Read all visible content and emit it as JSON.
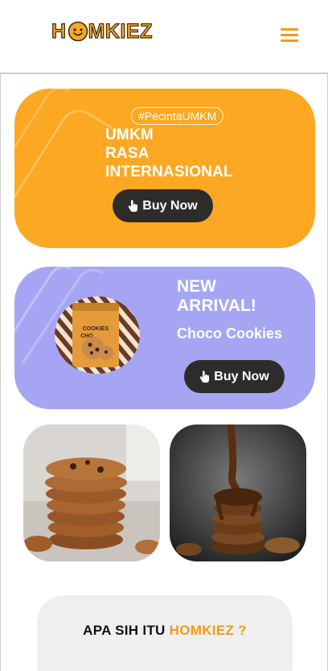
{
  "header": {
    "logo_text_1": "H",
    "logo_text_2": "MKIEZ",
    "menu_icon": "hamburger-icon"
  },
  "hero": {
    "hashtag": "#PecintaUMKM",
    "title_lines": [
      "UMKM",
      "RASA",
      "INTERNASIONAL"
    ],
    "button_label": "Buy Now",
    "button_icon": "pointing-hand-icon"
  },
  "arrival": {
    "title_lines": [
      "NEW",
      "ARRIVAL!"
    ],
    "subtitle": "Choco Cookies",
    "button_label": "Buy Now",
    "button_icon": "pointing-hand-icon",
    "product_label_1": "COOKIES",
    "product_label_2": "CHO"
  },
  "about": {
    "title_prefix": "APA SIH ITU ",
    "title_accent": "HOMKIEZ ?"
  },
  "colors": {
    "brand_orange": "#fca822",
    "arrival_purple": "#a6a5f4",
    "button_dark": "#2e2b2b",
    "accent": "#f39c12"
  }
}
